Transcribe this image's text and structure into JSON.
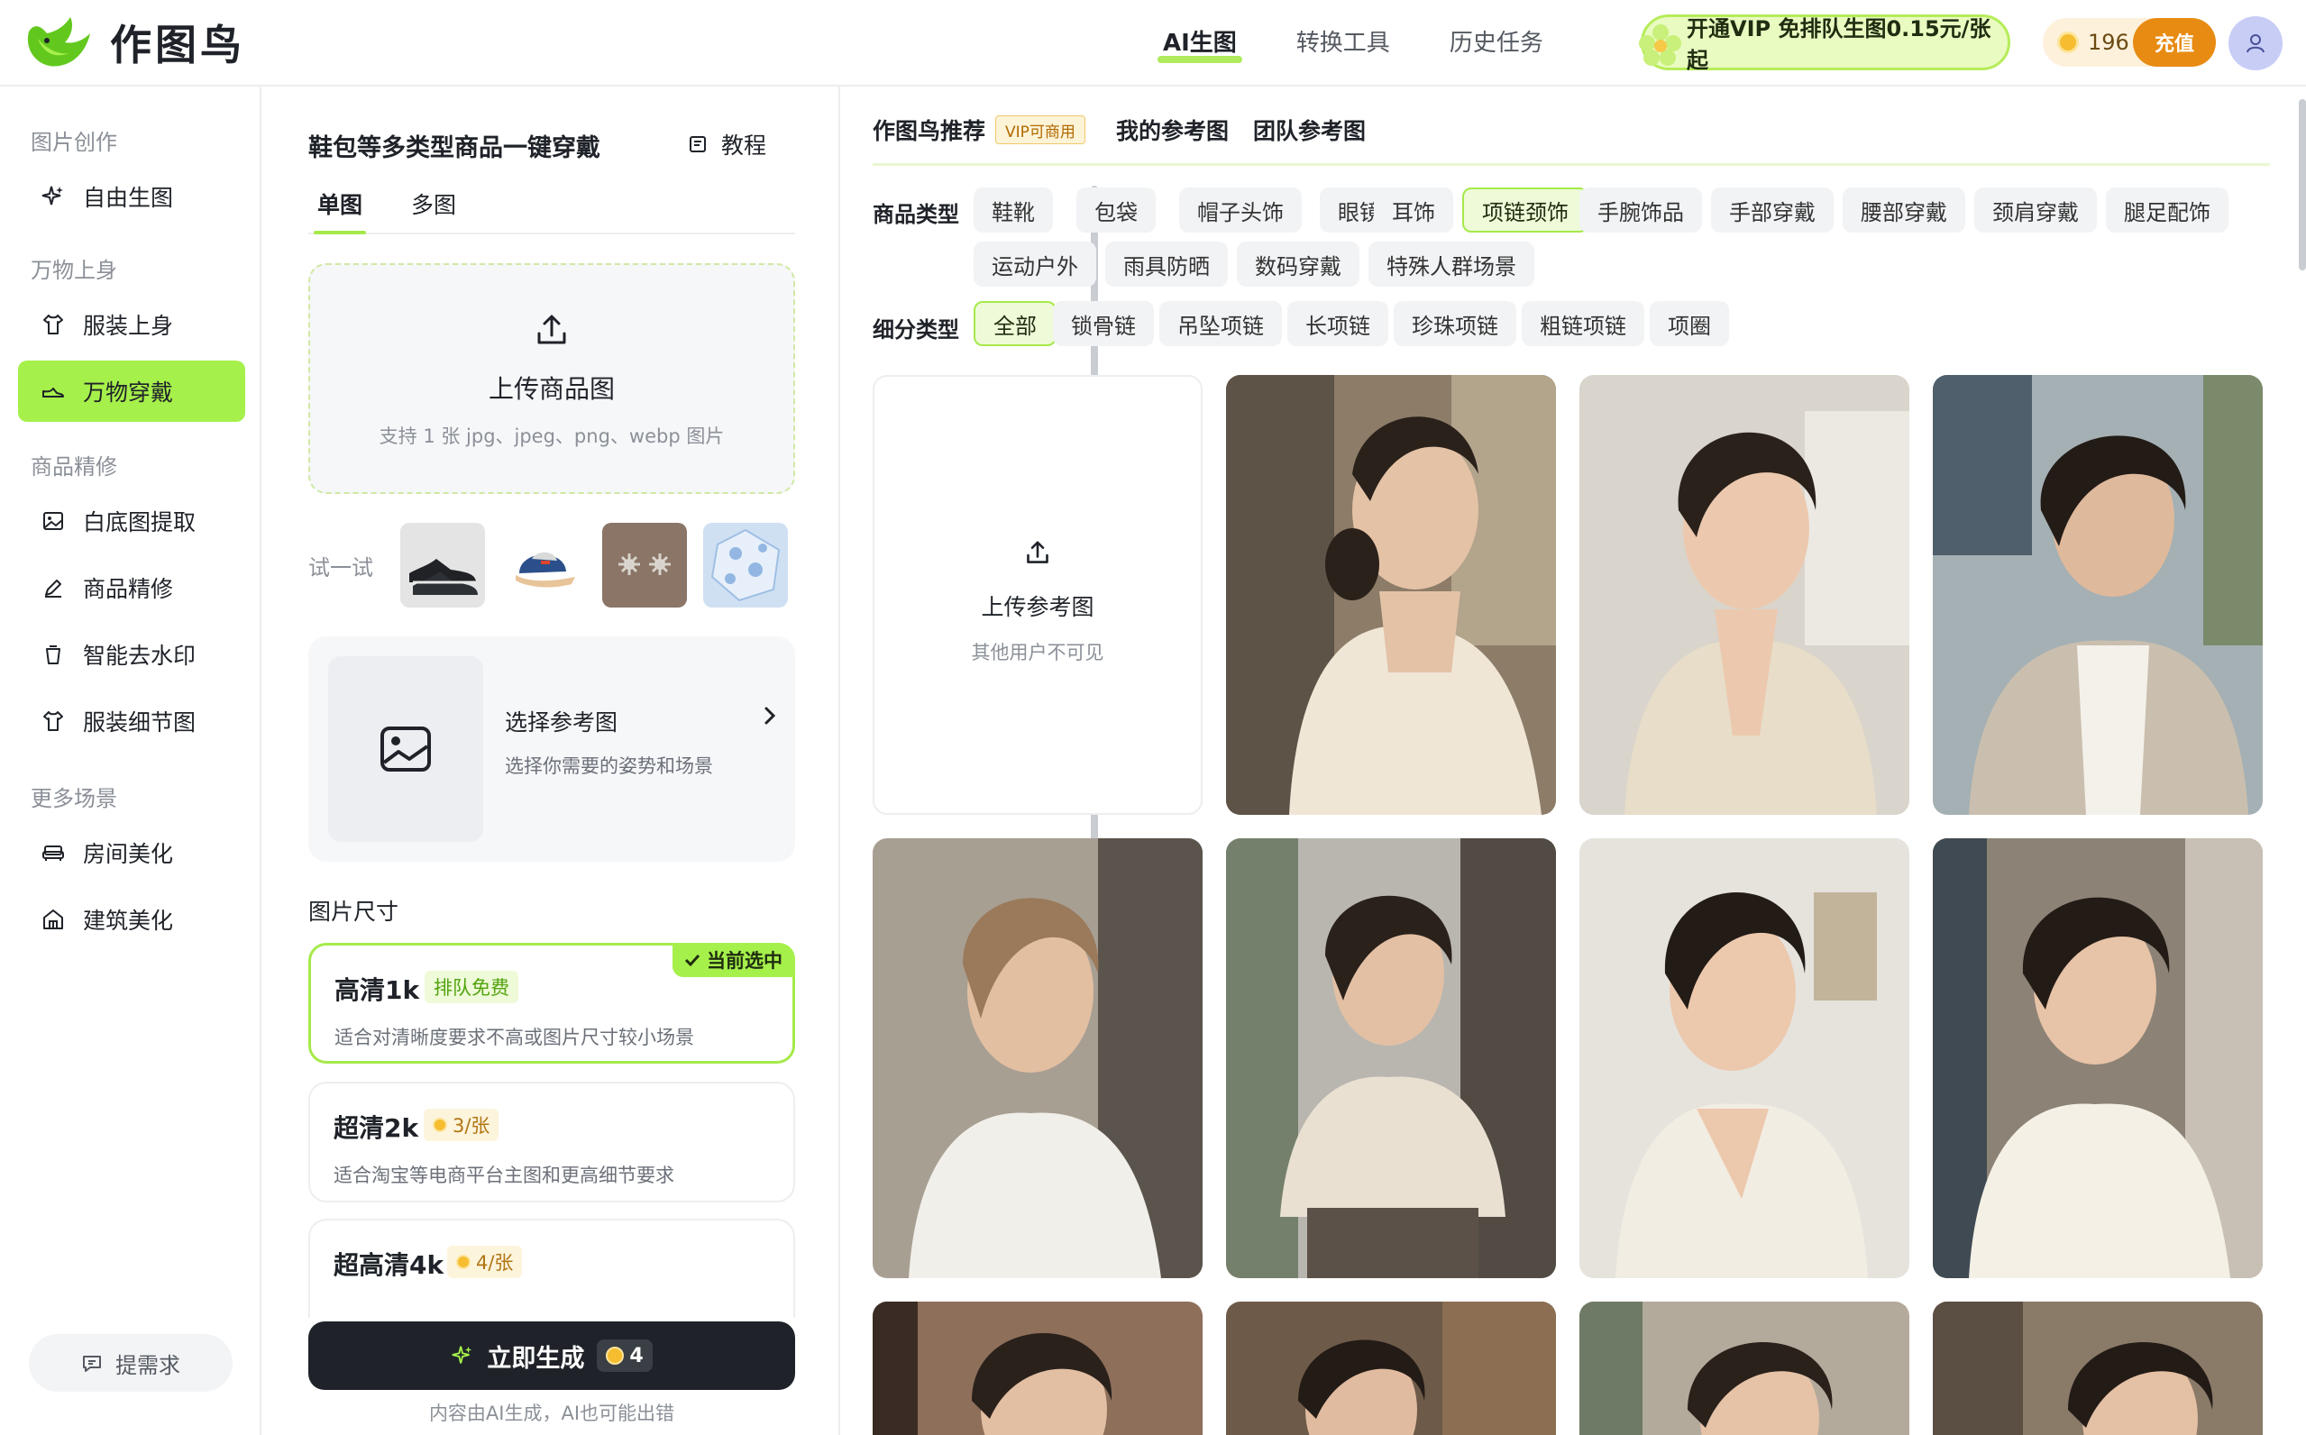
{
  "app": {
    "name": "作图鸟"
  },
  "nav": {
    "items": [
      "AI生图",
      "转换工具",
      "历史任务"
    ]
  },
  "vip": {
    "label": "开通VIP 免排队生图0.15元/张起"
  },
  "credits": {
    "count": "196",
    "recharge": "充值"
  },
  "sidebar": {
    "sections": [
      {
        "title": "图片创作",
        "items": [
          {
            "label": "自由生图",
            "icon": "sparkle-icon"
          }
        ]
      },
      {
        "title": "万物上身",
        "items": [
          {
            "label": "服装上身",
            "icon": "shirt-icon"
          },
          {
            "label": "万物穿戴",
            "icon": "shoe-icon",
            "active": true
          }
        ]
      },
      {
        "title": "商品精修",
        "items": [
          {
            "label": "白底图提取",
            "icon": "image-icon"
          },
          {
            "label": "商品精修",
            "icon": "pen-icon"
          },
          {
            "label": "智能去水印",
            "icon": "trash-icon"
          },
          {
            "label": "服装细节图",
            "icon": "shirt-icon"
          }
        ]
      },
      {
        "title": "更多场景",
        "items": [
          {
            "label": "房间美化",
            "icon": "sofa-icon"
          },
          {
            "label": "建筑美化",
            "icon": "building-icon"
          }
        ]
      }
    ],
    "feedback": "提需求"
  },
  "panel": {
    "title": "鞋包等多类型商品一键穿戴",
    "tutorial": "教程",
    "tabs": [
      "单图",
      "多图"
    ],
    "upload": {
      "title": "上传商品图",
      "hint": "支持 1 张 jpg、jpeg、png、webp 图片"
    },
    "try_label": "试一试",
    "samples": [
      "shoes-sample",
      "cap-sample",
      "earrings-sample",
      "umbrella-sample"
    ],
    "reference": {
      "title": "选择参考图",
      "hint": "选择你需要的姿势和场景"
    },
    "size_title": "图片尺寸",
    "sizes": [
      {
        "name": "高清1k",
        "tag": "排队免费",
        "desc": "适合对清晰度要求不高或图片尺寸较小场景",
        "badge": "当前选中"
      },
      {
        "name": "超清2k",
        "tag": "3/张",
        "desc": "适合淘宝等电商平台主图和更高细节要求"
      },
      {
        "name": "超高清4k",
        "tag": "4/张",
        "desc": ""
      }
    ],
    "generate": {
      "label": "立即生成",
      "cost": "4"
    },
    "disclaimer": "内容由AI生成，AI也可能出错"
  },
  "main": {
    "tabs": [
      "作图鸟推荐",
      "我的参考图",
      "团队参考图"
    ],
    "vip_tag": "VIP可商用",
    "category_label": "商品类型",
    "categories": [
      "鞋靴",
      "包袋",
      "帽子头饰",
      "眼镜",
      "耳饰",
      "项链颈饰",
      "手腕饰品",
      "手部穿戴",
      "腰部穿戴",
      "颈肩穿戴",
      "腿足配饰",
      "运动户外",
      "雨具防晒",
      "数码穿戴",
      "特殊人群场景"
    ],
    "selected_category": "项链颈饰",
    "subtype_label": "细分类型",
    "subtypes": [
      "全部",
      "锁骨链",
      "吊坠项链",
      "长项链",
      "珍珠项链",
      "粗链项链",
      "项圈"
    ],
    "selected_subtype": "全部",
    "upload_ref": {
      "title": "上传参考图",
      "hint": "其他用户不可见"
    }
  },
  "colors": {
    "accent": "#a6f04b",
    "dark": "#1f2329",
    "orange": "#e88b12"
  }
}
